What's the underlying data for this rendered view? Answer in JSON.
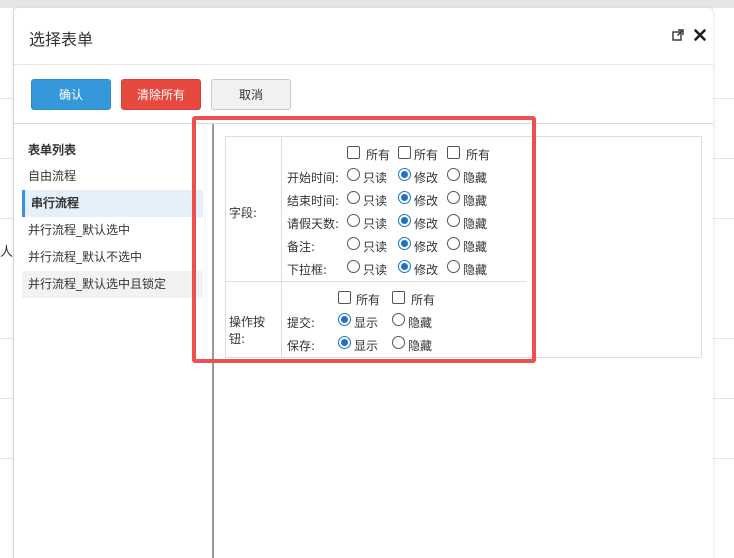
{
  "background": {
    "partial_char": "人"
  },
  "modal": {
    "title": "选择表单"
  },
  "toolbar": {
    "confirm": "确认",
    "clear_all": "清除所有",
    "cancel": "取消"
  },
  "sidebar": {
    "title": "表单列表",
    "items": [
      {
        "label": "自由流程",
        "active": false
      },
      {
        "label": "串行流程",
        "active": true
      },
      {
        "label": "并行流程_默认选中",
        "active": false
      },
      {
        "label": "并行流程_默认不选中",
        "active": false
      },
      {
        "label": "并行流程_默认选中且锁定",
        "active": false
      }
    ]
  },
  "fields": {
    "label": "字段:",
    "header": [
      "所有",
      "所有",
      "所有"
    ],
    "options": [
      "只读",
      "修改",
      "隐藏"
    ],
    "rows": [
      {
        "name": "开始时间:",
        "selected": "修改"
      },
      {
        "name": "结束时间:",
        "selected": "修改"
      },
      {
        "name": "请假天数:",
        "selected": "修改"
      },
      {
        "name": "备注:",
        "selected": "修改"
      },
      {
        "name": "下拉框:",
        "selected": "修改"
      }
    ]
  },
  "buttons": {
    "label": "操作按钮:",
    "header": [
      "所有",
      "所有"
    ],
    "options": [
      "显示",
      "隐藏"
    ],
    "rows": [
      {
        "name": "提交:",
        "selected": "显示"
      },
      {
        "name": "保存:",
        "selected": "显示"
      }
    ]
  },
  "colors": {
    "primary": "#3498db",
    "danger": "#e8493f",
    "highlight": "#f04f4f",
    "radio": "#1e73c8"
  }
}
